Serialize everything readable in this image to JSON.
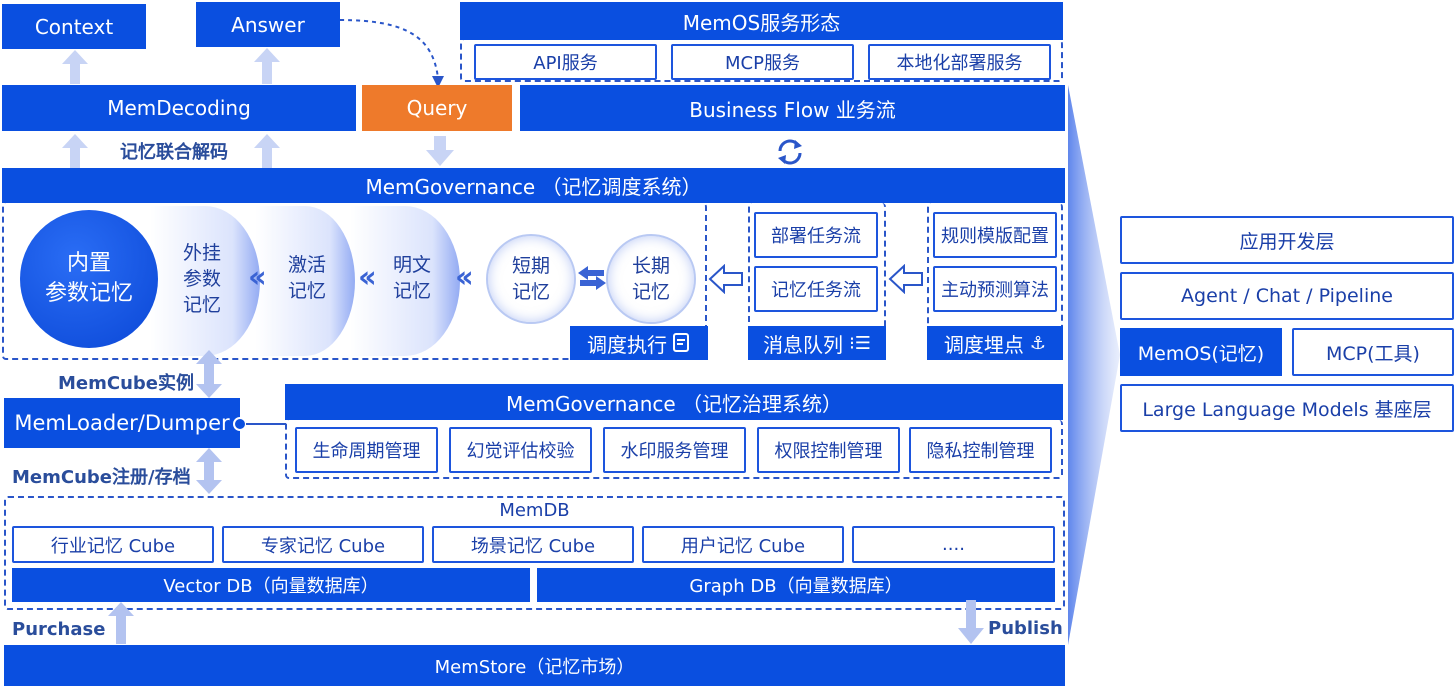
{
  "top": {
    "context": "Context",
    "answer": "Answer",
    "memdecoding": "MemDecoding",
    "query": "Query",
    "business_flow": "Business Flow 业务流",
    "decode_label": "记忆联合解码"
  },
  "service": {
    "title": "MemOS服务形态",
    "items": [
      "API服务",
      "MCP服务",
      "本地化部署服务"
    ]
  },
  "scheduler": {
    "title": "MemGovernance （记忆调度系统）",
    "builtin": "内置\n参数记忆",
    "external": "外挂\n参数\n记忆",
    "activated": "激活\n记忆",
    "plaintext": "明文\n记忆",
    "short": "短期\n记忆",
    "long": "长期\n记忆",
    "exec": "调度执行",
    "queue_items": [
      "部署任务流",
      "记忆任务流"
    ],
    "queue": "消息队列",
    "rule_items": [
      "规则模版配置",
      "主动预测算法"
    ],
    "hook": "调度埋点"
  },
  "loader": {
    "memcube_instance": "MemCube实例",
    "loader": "MemLoader/Dumper",
    "register": "MemCube注册/存档"
  },
  "governance": {
    "title": "MemGovernance （记忆治理系统）",
    "items": [
      "生命周期管理",
      "幻觉评估校验",
      "水印服务管理",
      "权限控制管理",
      "隐私控制管理"
    ]
  },
  "memdb": {
    "title": "MemDB",
    "cubes": [
      "行业记忆 Cube",
      "专家记忆 Cube",
      "场景记忆 Cube",
      "用户记忆 Cube",
      "...."
    ],
    "vector": "Vector DB（向量数据库）",
    "graph": "Graph DB（向量数据库）"
  },
  "store": {
    "purchase": "Purchase",
    "publish": "Publish",
    "memstore": "MemStore（记忆市场）"
  },
  "stack": {
    "app": "应用开发层",
    "agent": "Agent / Chat / Pipeline",
    "memos": "MemOS(记忆)",
    "mcp": "MCP(工具)",
    "llm": "Large Language Models 基座层"
  },
  "colors": {
    "primary": "#0a4fe0",
    "accent": "#ee7a2b",
    "outline": "#1d55dd"
  }
}
